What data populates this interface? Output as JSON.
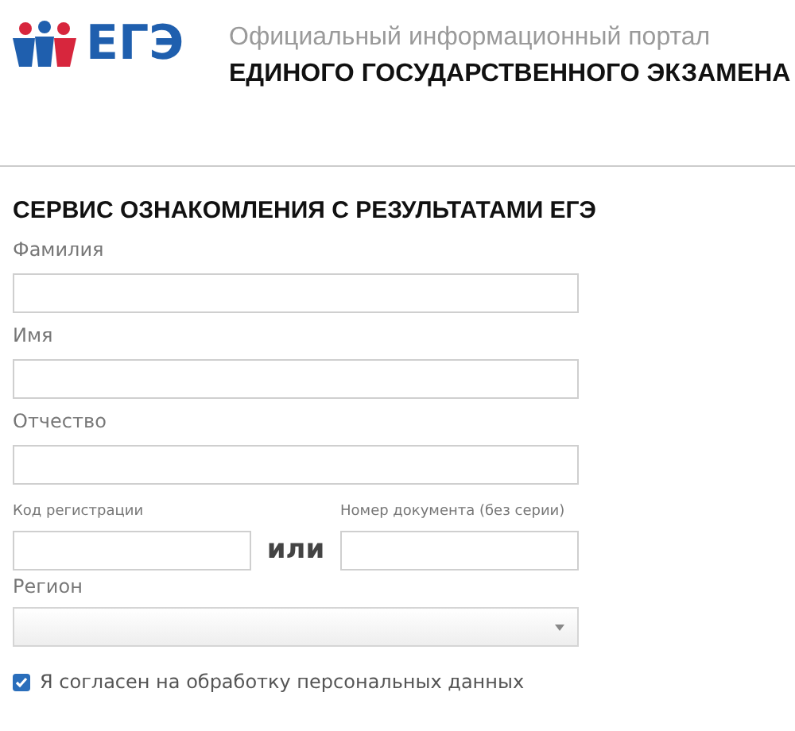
{
  "header": {
    "logo_text": "ЕГЭ",
    "subtitle": "Официальный информационный портал",
    "title": "ЕДИНОГО ГОСУДАРСТВЕННОГО ЭКЗАМЕНА"
  },
  "form": {
    "title": "СЕРВИС ОЗНАКОМЛЕНИЯ С РЕЗУЛЬТАТАМИ ЕГЭ",
    "fields": [
      {
        "label": "Фамилия"
      },
      {
        "label": "Имя"
      },
      {
        "label": "Отчество"
      }
    ],
    "registration": {
      "label": "Код регистрации"
    },
    "separator": "или",
    "document": {
      "label": "Номер документа (без серии)"
    },
    "region": {
      "label": "Регион"
    },
    "consent": {
      "label": "Я согласен на обработку персональных данных",
      "checked": true
    }
  }
}
